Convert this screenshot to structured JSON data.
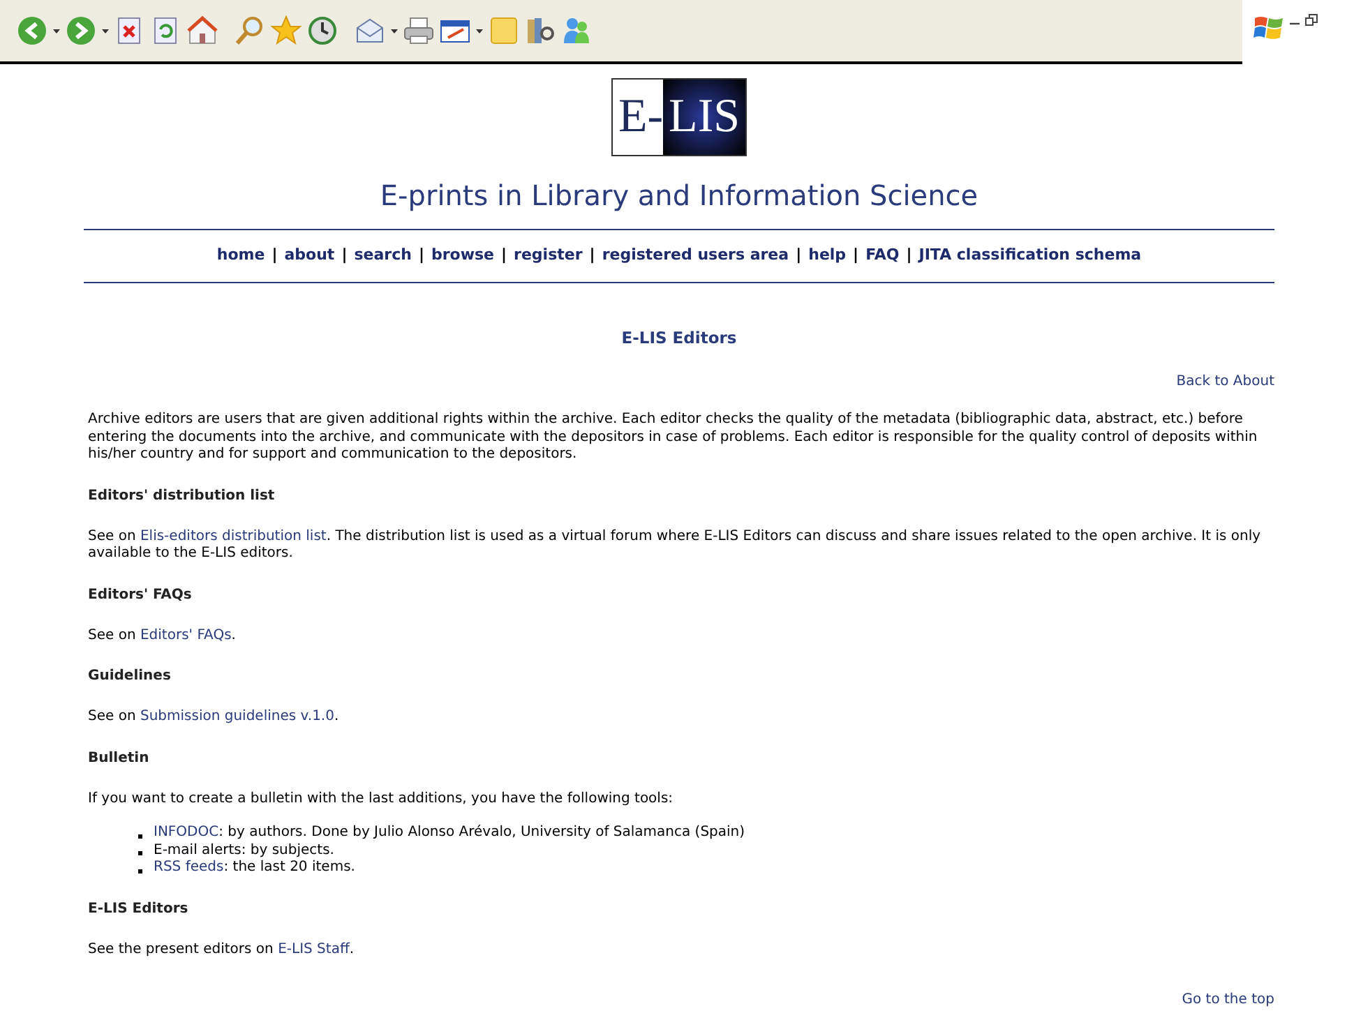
{
  "logo": {
    "left": "E-",
    "right": "LIS"
  },
  "site_title": "E-prints in Library and Information Science",
  "nav": {
    "separator": "|",
    "items": [
      {
        "label": "home"
      },
      {
        "label": "about"
      },
      {
        "label": "search"
      },
      {
        "label": "browse"
      },
      {
        "label": "register"
      },
      {
        "label": "registered users area"
      },
      {
        "label": "help"
      },
      {
        "label": "FAQ"
      },
      {
        "label": "JITA classification schema"
      }
    ]
  },
  "page_heading": "E-LIS Editors",
  "back_link": "Back to About",
  "intro": "Archive editors are users that are given additional rights within the archive. Each editor checks the quality of the metadata (bibliographic data, abstract, etc.) before entering the documents into the archive, and communicate with the depositors in case of problems. Each editor is responsible for the quality control of deposits within his/her country and for support and communication to the depositors.",
  "sections": [
    {
      "heading": "Editors' distribution list",
      "paragraph": [
        {
          "kind": "text",
          "text": "See on "
        },
        {
          "kind": "link",
          "text": "Elis-editors distribution list"
        },
        {
          "kind": "text",
          "text": ". The distribution list is used as a virtual forum where E-LIS Editors can discuss and share issues related to the open archive. It is only available to the E-LIS editors."
        }
      ]
    },
    {
      "heading": "Editors' FAQs",
      "paragraph": [
        {
          "kind": "text",
          "text": "See on "
        },
        {
          "kind": "link",
          "text": "Editors' FAQs"
        },
        {
          "kind": "text",
          "text": "."
        }
      ]
    },
    {
      "heading": "Guidelines",
      "paragraph": [
        {
          "kind": "text",
          "text": "See on "
        },
        {
          "kind": "link",
          "text": "Submission guidelines v.1.0"
        },
        {
          "kind": "text",
          "text": "."
        }
      ]
    },
    {
      "heading": "Bulletin",
      "paragraph": [
        {
          "kind": "text",
          "text": "If you want to create a bulletin with the last additions, you have the following tools:"
        }
      ],
      "list": [
        [
          {
            "kind": "link",
            "text": "INFODOC"
          },
          {
            "kind": "text",
            "text": ": by authors. Done by Julio Alonso Arévalo, University of Salamanca (Spain)"
          }
        ],
        [
          {
            "kind": "text",
            "text": "E-mail alerts: by subjects."
          }
        ],
        [
          {
            "kind": "link",
            "text": "RSS feeds"
          },
          {
            "kind": "text",
            "text": ": the last 20 items."
          }
        ]
      ]
    },
    {
      "heading": "E-LIS Editors",
      "paragraph": [
        {
          "kind": "text",
          "text": "See the present editors on "
        },
        {
          "kind": "link",
          "text": "E-LIS Staff"
        },
        {
          "kind": "text",
          "text": "."
        }
      ]
    }
  ],
  "top_link": "Go to the top"
}
